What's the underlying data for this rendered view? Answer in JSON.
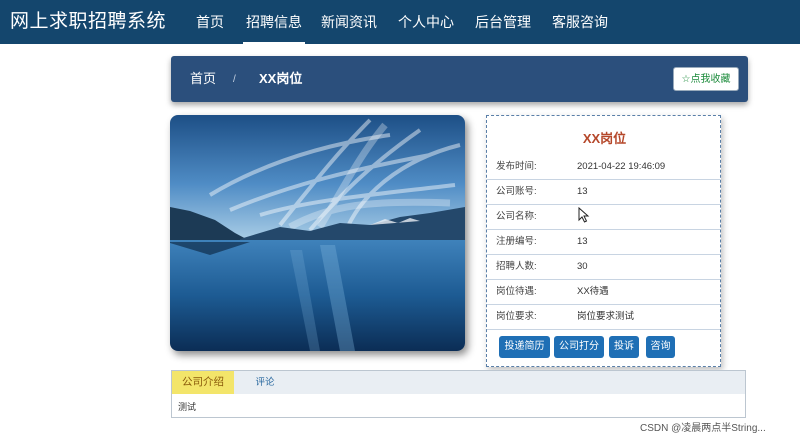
{
  "site_title": "网上求职招聘系统",
  "nav": [
    "首页",
    "招聘信息",
    "新闻资讯",
    "个人中心",
    "后台管理",
    "客服咨询"
  ],
  "nav_active_index": 1,
  "breadcrumb": {
    "home": "首页",
    "separator": "/",
    "current": "XX岗位"
  },
  "favorite_button": "☆点我收藏",
  "job": {
    "title": "XX岗位",
    "fields": [
      {
        "label": "发布时间:",
        "value": "2021-04-22 19:46:09"
      },
      {
        "label": "公司账号:",
        "value": "13"
      },
      {
        "label": "公司名称:",
        "value": ""
      },
      {
        "label": "注册编号:",
        "value": "13"
      },
      {
        "label": "招聘人数:",
        "value": "30"
      },
      {
        "label": "岗位待遇:",
        "value": "XX待遇"
      },
      {
        "label": "岗位要求:",
        "value": "岗位要求测试"
      }
    ],
    "actions": [
      "投递简历",
      "公司打分",
      "投诉",
      "咨询"
    ]
  },
  "tabs": {
    "items": [
      "公司介绍",
      "评论"
    ],
    "active_index": 0,
    "content": "测试"
  },
  "watermark": "CSDN @凌晨两点半String..."
}
